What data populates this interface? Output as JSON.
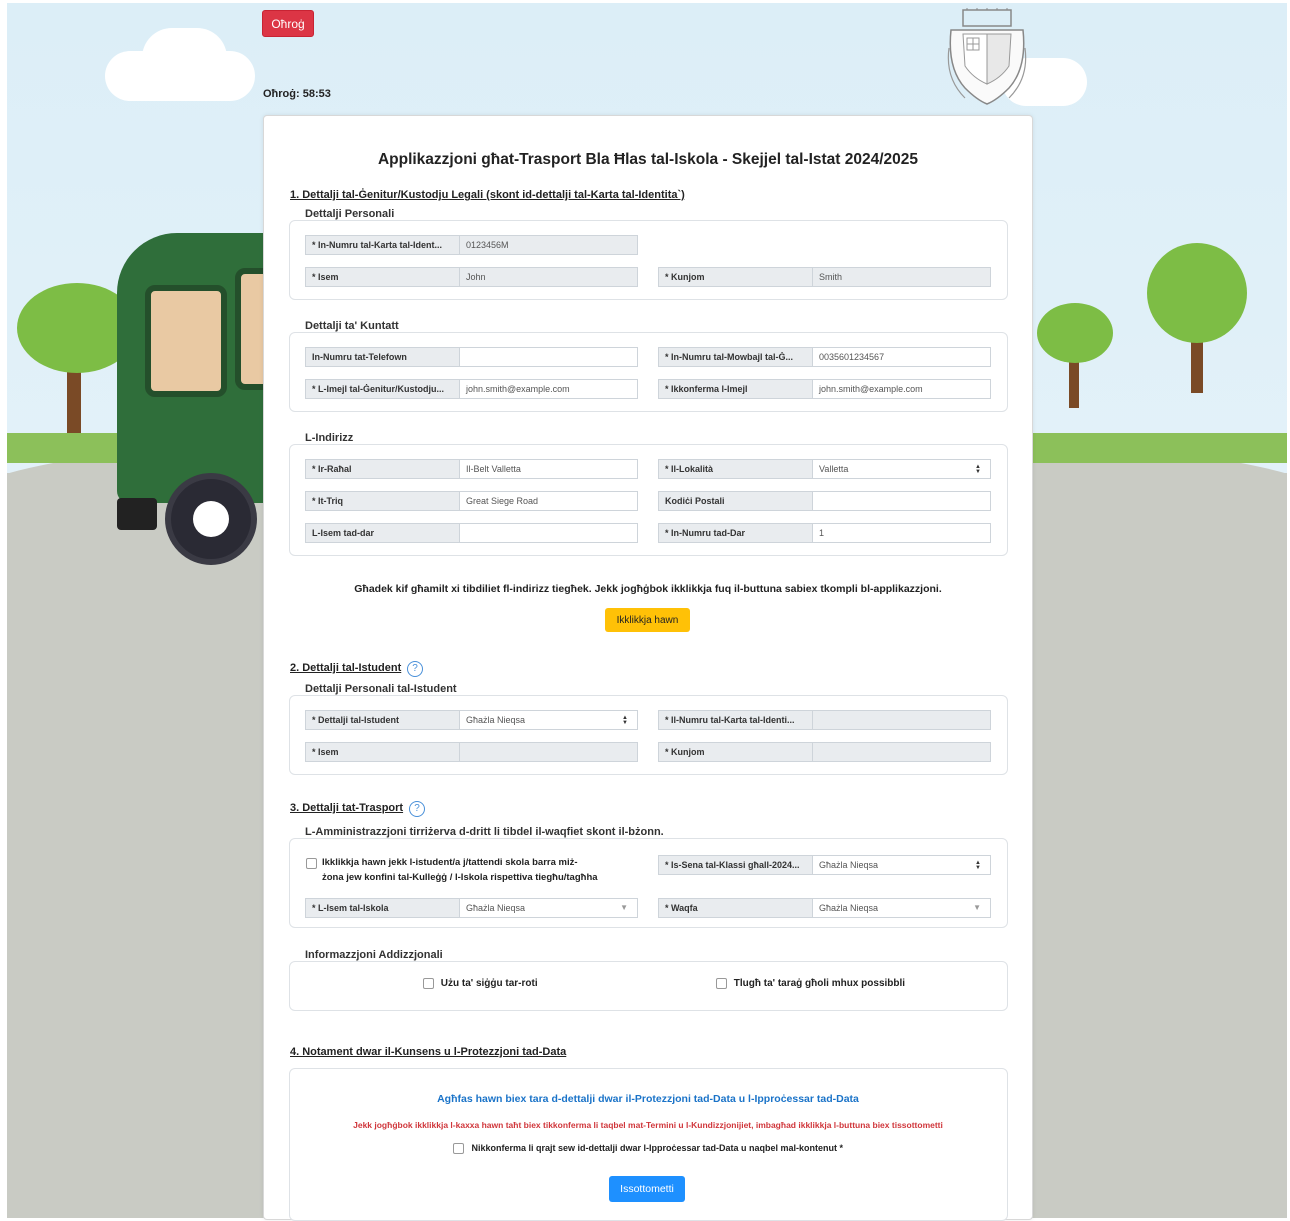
{
  "header": {
    "exit_label": "Oħroġ",
    "timer_text": "Oħroġ: 58:53"
  },
  "form": {
    "title": "Applikazzjoni għat-Trasport Bla Ħlas tal-Iskola - Skejjel tal-Istat 2024/2025",
    "section1": {
      "heading": "1. Dettalji tal-Ġenitur/Kustodju Legali (skont id-dettalji tal-Karta tal-Identita`)",
      "personal": {
        "legend": "Dettalji Personali",
        "id_label": "* In-Numru tal-Karta tal-Ident...",
        "id_value": "0123456M",
        "name_label": "* Isem",
        "name_value": "John",
        "surname_label": "* Kunjom",
        "surname_value": "Smith"
      },
      "contact": {
        "legend": "Dettalji ta' Kuntatt",
        "phone_label": "In-Numru tat-Telefown",
        "phone_value": "",
        "mobile_label": "* In-Numru tal-Mowbajl tal-Ġ...",
        "mobile_value": "0035601234567",
        "email_label": "* L-Imejl tal-Ġenitur/Kustodju...",
        "email_value": "john.smith@example.com",
        "confirm_label": "* Ikkonferma l-Imejl",
        "confirm_value": "john.smith@example.com"
      },
      "address": {
        "legend": "L-Indirizz",
        "village_label": "* Ir-Raħal",
        "village_value": "Il-Belt Valletta",
        "locality_label": "* Il-Lokalità",
        "locality_value": "Valletta",
        "street_label": "* It-Triq",
        "street_value": "Great Siege Road",
        "postcode_label": "Kodiċi Postali",
        "postcode_value": "",
        "house_name_label": "L-Isem tad-dar",
        "house_name_value": "",
        "house_no_label": "* In-Numru tad-Dar",
        "house_no_value": "1"
      },
      "address_notice": "Għadek kif għamilt xi tibdiliet fl-indirizz tiegħek. Jekk jogħġbok ikklikkja fuq il-buttuna sabiex tkompli bl-applikazzjoni.",
      "click_here": "Ikklikkja hawn"
    },
    "section2": {
      "heading": "2. Dettalji tal-Istudent",
      "help_icon": "?",
      "legend": "Dettalji Personali tal-Istudent",
      "student_label": "* Dettalji tal-Istudent",
      "student_value": "Għażla Nieqsa",
      "id_label": "* Il-Numru tal-Karta tal-Identi...",
      "id_value": "",
      "name_label": "* Isem",
      "name_value": "",
      "surname_label": "* Kunjom",
      "surname_value": ""
    },
    "section3": {
      "heading": "3. Dettalji tat-Trasport",
      "help_icon": "?",
      "legend": "L-Amministrazzjoni tirriżerva d-dritt li tibdel il-waqfiet skont il-bżonn.",
      "outside_zone_line1": "Ikklikkja hawn jekk l-istudent/a j/tattendi skola barra miż-",
      "outside_zone_line2": "żona jew konfini tal-Kulleġġ / l-Iskola rispettiva tiegħu/tagħha",
      "year_label": "* Is-Sena tal-Klassi għall-2024...",
      "year_value": "Għażla Nieqsa",
      "school_label": "* L-Isem tal-Iskola",
      "school_value": "Għażla Nieqsa",
      "stop_label": "* Waqfa",
      "stop_value": "Għażla Nieqsa",
      "additional_legend": "Informazzjoni Addizzjonali",
      "wheelchair_label": "Użu ta' siġġu tar-roti",
      "stairs_label": "Tlugħ ta' taraġ għoli mhux possibbli"
    },
    "section4": {
      "heading": "4. Notament dwar il-Kunsens u l-Protezzjoni tad-Data",
      "data_link": "Agħfas hawn biex tara d-dettalji dwar il-Protezzjoni tad-Data u l-Ipproċessar tad-Data",
      "instruction": "Jekk jogħġbok ikklikkja l-kaxxa hawn taħt biex tikkonferma li taqbel mat-Termini u l-Kundizzjonijiet, imbagħad ikklikkja l-buttuna biex tissottometti",
      "consent_label": "Nikkonferma li qrajt sew id-dettalji dwar l-Ipproċessar tad-Data u naqbel mal-kontenut *",
      "submit_label": "Issottometti"
    }
  },
  "colors": {
    "exit": "#dc3545",
    "click_here": "#ffc107",
    "submit": "#1e90ff",
    "link": "#1a73c8",
    "warning_text": "#d0363b"
  },
  "icons": {
    "emblem": "malta-coat-of-arms-icon",
    "select_caret": "select-caret-icon"
  }
}
